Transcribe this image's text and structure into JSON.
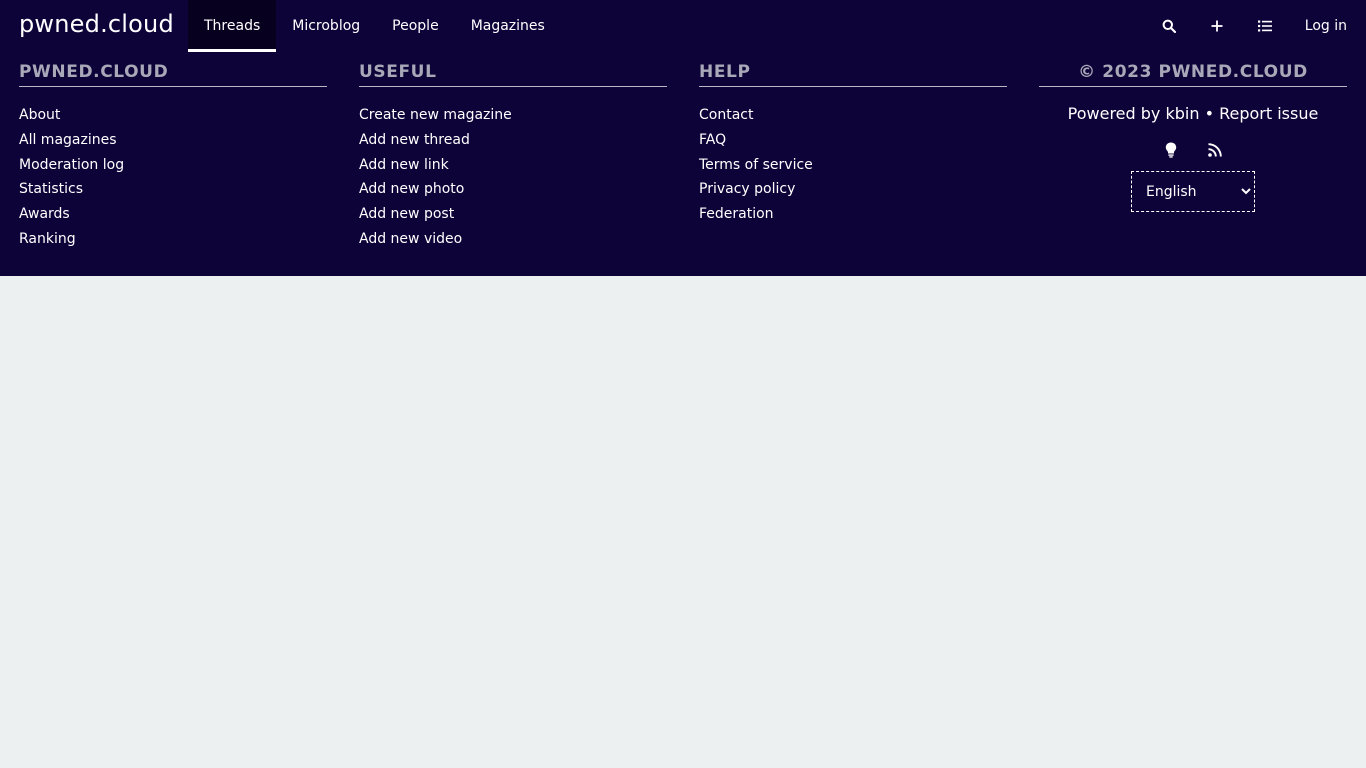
{
  "header": {
    "brand": "pwned.cloud",
    "nav": [
      {
        "label": "Threads",
        "active": true
      },
      {
        "label": "Microblog",
        "active": false
      },
      {
        "label": "People",
        "active": false
      },
      {
        "label": "Magazines",
        "active": false
      }
    ],
    "icons": [
      "search-icon",
      "plus-icon",
      "list-icon"
    ],
    "login_label": "Log in"
  },
  "footer": {
    "col1": {
      "title": "PWNED.CLOUD",
      "links": [
        "About",
        "All magazines",
        "Moderation log",
        "Statistics",
        "Awards",
        "Ranking"
      ]
    },
    "col2": {
      "title": "USEFUL",
      "links": [
        "Create new magazine",
        "Add new thread",
        "Add new link",
        "Add new photo",
        "Add new post",
        "Add new video"
      ]
    },
    "col3": {
      "title": "HELP",
      "links": [
        "Contact",
        "FAQ",
        "Terms of service",
        "Privacy policy",
        "Federation"
      ]
    },
    "col4": {
      "title": "© 2023 PWNED.CLOUD",
      "powered_prefix": "Powered by",
      "powered_link": "kbin",
      "separator": "•",
      "report_link": "Report issue",
      "icons": [
        "lightbulb-icon",
        "rss-icon"
      ],
      "language": "English"
    }
  },
  "colors": {
    "header_bg": "#0d0339",
    "page_bg": "#ecf0f1",
    "heading_text": "#a9a8b8"
  }
}
